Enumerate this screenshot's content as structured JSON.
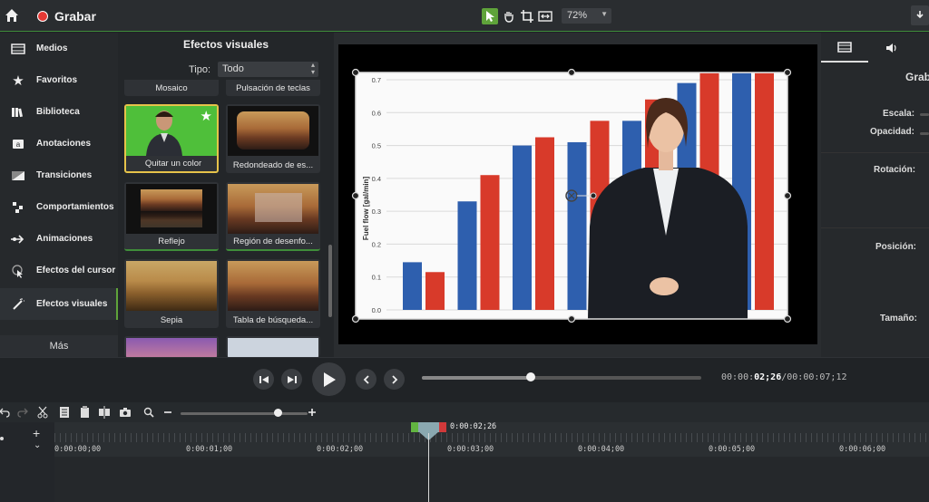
{
  "topbar": {
    "record_label": "Grabar",
    "zoom": "72%"
  },
  "sidebar": {
    "items": [
      {
        "label": "Medios",
        "icon": "film-icon"
      },
      {
        "label": "Favoritos",
        "icon": "star-icon"
      },
      {
        "label": "Biblioteca",
        "icon": "library-icon"
      },
      {
        "label": "Anotaciones",
        "icon": "annotation-icon"
      },
      {
        "label": "Transiciones",
        "icon": "transition-icon"
      },
      {
        "label": "Comportamientos",
        "icon": "behaviors-icon"
      },
      {
        "label": "Animaciones",
        "icon": "animation-icon"
      },
      {
        "label": "Efectos del cursor",
        "icon": "cursor-effect-icon"
      },
      {
        "label": "Efectos visuales",
        "icon": "wand-icon"
      }
    ],
    "more": "Más"
  },
  "effects": {
    "title": "Efectos visuales",
    "type_label": "Tipo:",
    "type_value": "Todo",
    "top_labels": [
      "Mosaico",
      "Pulsación de teclas"
    ],
    "tiles": [
      {
        "caption": "Quitar un color"
      },
      {
        "caption": "Redondeado de es..."
      },
      {
        "caption": "Reflejo"
      },
      {
        "caption": "Región de desenfo..."
      },
      {
        "caption": "Sepia"
      },
      {
        "caption": "Tabla de búsqueda..."
      }
    ]
  },
  "preview": {
    "chart_ylabel": "Fuel flow [gal/min]",
    "yticks": [
      "0.7",
      "0.6",
      "0.5",
      "0.4",
      "0.3",
      "0.2",
      "0.1",
      "0.0"
    ]
  },
  "chart_data": {
    "type": "bar",
    "ylabel": "Fuel flow [gal/min]",
    "ylim": [
      0,
      0.7
    ],
    "series": [
      {
        "values": [
          0.145,
          0.33,
          0.5,
          0.51,
          0.575,
          0.69,
          0.72
        ],
        "color": "#2e5fae"
      },
      {
        "values": [
          0.115,
          0.41,
          0.525,
          0.575,
          0.64,
          0.72,
          0.72
        ],
        "color": "#d83a2a"
      }
    ]
  },
  "properties": {
    "header": "Grab",
    "scale": "Escala:",
    "opacity": "Opacidad:",
    "rotation": "Rotación:",
    "position": "Posición:",
    "size": "Tamaño:"
  },
  "playback": {
    "current": "00:00:02;26",
    "current_prefix": "00:00:",
    "current_bold": "02;26",
    "total": "/00:00:07;12",
    "progress": 0.38
  },
  "timeline": {
    "playhead_label": "0:00:02;26",
    "ticks": [
      "0:00:00;00",
      "0:00:01;00",
      "0:00:02;00",
      "0:00:03;00",
      "0:00:04;00",
      "0:00:05;00",
      "0:00:06;00"
    ]
  },
  "colors": {
    "accent": "#5fa33a",
    "record": "#e53935"
  }
}
